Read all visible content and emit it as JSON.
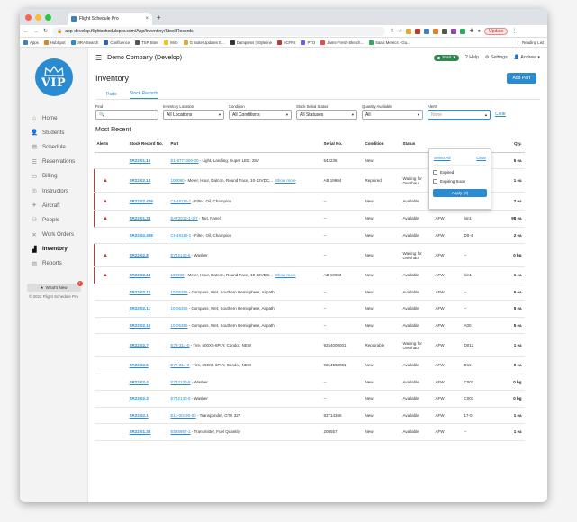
{
  "browser": {
    "tab_title": "Flight Schedule Pro",
    "url": "app-develop.flightschedulepro.com/App/Inventory/StockRecords",
    "update_label": "Update",
    "bookmarks": [
      "Apps",
      "HubSpot",
      "JIRA Search",
      "Confluence",
      "TSP Sites",
      "Miro",
      "G Suite Updates B...",
      "Dampress | Styleline",
      "eCFRs",
      "PTO",
      "Jams-Fresh-Sketch...",
      "SaaS Metrics - Gu..."
    ],
    "reading_list": "Reading List"
  },
  "sidebar": {
    "logo_text": "VIP",
    "items": [
      {
        "label": "Home",
        "icon": "home-icon",
        "glyph": "⌂"
      },
      {
        "label": "Students",
        "icon": "student-icon",
        "glyph": "👤"
      },
      {
        "label": "Schedule",
        "icon": "calendar-icon",
        "glyph": "▤"
      },
      {
        "label": "Reservations",
        "icon": "list-icon",
        "glyph": "☰"
      },
      {
        "label": "Billing",
        "icon": "billing-icon",
        "glyph": "▭"
      },
      {
        "label": "Instructors",
        "icon": "instructor-icon",
        "glyph": "◎"
      },
      {
        "label": "Aircraft",
        "icon": "airplane-icon",
        "glyph": "✈"
      },
      {
        "label": "People",
        "icon": "people-icon",
        "glyph": "⚇"
      },
      {
        "label": "Work Orders",
        "icon": "wrench-icon",
        "glyph": "✕"
      },
      {
        "label": "Inventory",
        "icon": "inventory-icon",
        "glyph": "▟"
      },
      {
        "label": "Reports",
        "icon": "chart-icon",
        "glyph": "▥"
      }
    ],
    "whats_new": "What's New",
    "whats_new_badge": "1",
    "copyright": "© 2022 Flight Schedule Pro"
  },
  "topbar": {
    "company": "Demo Company (Develop)",
    "start_label": "Start",
    "help_label": "Help",
    "settings_label": "Settings",
    "user_label": "Andrew"
  },
  "page": {
    "title": "Inventory",
    "add_button": "Add Part",
    "tabs": [
      "Parts",
      "Stock Records"
    ],
    "most_recent": "Most Recent"
  },
  "filters": {
    "find_label": "Find",
    "location_label": "Inventory Location",
    "location_value": "All Locations",
    "condition_label": "Condition",
    "condition_value": "All Conditions",
    "serial_label": "Stock Serial Status",
    "serial_value": "All Statuses",
    "qty_label": "Quantity Available",
    "qty_value": "All",
    "alerts_label": "Alerts",
    "alerts_placeholder": "None",
    "clear_label": "Clear"
  },
  "alerts_dropdown": {
    "select_all": "Select All",
    "clear": "Clear",
    "options": [
      "Expired",
      "Expiring Soon"
    ],
    "apply": "Apply (0)"
  },
  "table": {
    "headers": [
      "Alerts",
      "Stock Record No.",
      "Part",
      "Serial No.",
      "Condition",
      "Status",
      "",
      "",
      "Qty."
    ],
    "rows": [
      {
        "alert": false,
        "no": "SR22.01.16",
        "pn": "E1-8771000-00",
        "desc": " - Light, Landing, Super LED, 28V",
        "more": "",
        "serial": "542236",
        "condition": "New",
        "status": "",
        "loc": "",
        "bin": "",
        "qty": "5 ea"
      },
      {
        "alert": true,
        "no": "SR22.02.14",
        "pn": "100090",
        "desc": " - Meter, Hour, Datcon, Round Face, 10-32VDC...",
        "more": "Show more",
        "serial": "AB 19904",
        "condition": "Repaired",
        "status": "Waiting for Overhaul",
        "loc": "AFW",
        "bin": "--",
        "qty": "1 ea"
      },
      {
        "alert": true,
        "no": "SR22.02.429",
        "pn": "CH48110-1",
        "desc": " - Filter, Oil, Champion",
        "more": "",
        "serial": "--",
        "condition": "New",
        "status": "Available",
        "loc": "STO",
        "bin": "048-6",
        "qty": "7 ea"
      },
      {
        "alert": true,
        "no": "SR22.01.33",
        "pn": "EAT2012-1-2/7",
        "desc": " - Nut, Panel",
        "more": "",
        "serial": "--",
        "condition": "New",
        "status": "Available",
        "loc": "AFW",
        "bin": "bin1",
        "qty": "98 ea"
      },
      {
        "alert": false,
        "no": "SR22.02.408",
        "pn": "CH48110-1",
        "desc": " - Filter, Oil, Champion",
        "more": "",
        "serial": "--",
        "condition": "New",
        "status": "Available",
        "loc": "AFW",
        "bin": "D0-4",
        "qty": "2 ea"
      },
      {
        "alert": true,
        "no": "SR22.02.8",
        "pn": "E742130-5",
        "desc": " - Washer",
        "more": "",
        "serial": "--",
        "condition": "New",
        "status": "Waiting for Overhaul",
        "loc": "AFW",
        "bin": "--",
        "qty": "0 bg"
      },
      {
        "alert": true,
        "no": "SR22.02.13",
        "pn": "100090",
        "desc": " - Meter, Hour, Datcon, Round Face, 10-32VDC...",
        "more": "Show more",
        "serial": "AB 19903",
        "condition": "New",
        "status": "Available",
        "loc": "AFW",
        "bin": "bin1",
        "qty": "1 ea"
      },
      {
        "alert": false,
        "no": "SR22.02.12",
        "pn": "10-05355",
        "desc": " - Compass, Wet, Southern Hemisphere, Airpath",
        "more": "",
        "serial": "--",
        "condition": "New",
        "status": "Available",
        "loc": "AFW",
        "bin": "--",
        "qty": "5 ea"
      },
      {
        "alert": false,
        "no": "SR22.02.11",
        "pn": "10-05355",
        "desc": " - Compass, Wet, Southern Hemisphere, Airpath",
        "more": "",
        "serial": "--",
        "condition": "New",
        "status": "Available",
        "loc": "AFW",
        "bin": "--",
        "qty": "5 ea"
      },
      {
        "alert": false,
        "no": "SR22.02.10",
        "pn": "10-05355",
        "desc": " - Compass, Wet, Southern Hemisphere, Airpath",
        "more": "",
        "serial": "--",
        "condition": "New",
        "status": "Available",
        "loc": "AFW",
        "bin": "A00",
        "qty": "5 ea"
      },
      {
        "alert": false,
        "no": "SR22.02.7",
        "pn": "E72-314-0",
        "desc": " - Tire, 600X6-6PLY, Condor, NEW",
        "more": "",
        "serial": "9254000001",
        "condition": "Repairable",
        "status": "Waiting for Overhaul",
        "loc": "AFW",
        "bin": "D012",
        "qty": "1 ea"
      },
      {
        "alert": false,
        "no": "SR22.02.6",
        "pn": "E72-314-0",
        "desc": " - Tire, 600X6-6PLY, Condor, NEW",
        "more": "",
        "serial": "9254500001",
        "condition": "New",
        "status": "Available",
        "loc": "AFW",
        "bin": "D11",
        "qty": "0 ea"
      },
      {
        "alert": false,
        "no": "SR22.02.4",
        "pn": "E742130-5",
        "desc": " - Washer",
        "more": "",
        "serial": "--",
        "condition": "New",
        "status": "Available",
        "loc": "AFW",
        "bin": "C002",
        "qty": "0 bg"
      },
      {
        "alert": false,
        "no": "SR22.02.3",
        "pn": "E742130-5",
        "desc": " - Washer",
        "more": "",
        "serial": "--",
        "condition": "New",
        "status": "Available",
        "loc": "AFW",
        "bin": "C001",
        "qty": "0 bg"
      },
      {
        "alert": false,
        "no": "SR22.02.1",
        "pn": "E11-00430-00",
        "desc": " - Transponder, GTX 327",
        "more": "",
        "serial": "83714366",
        "condition": "New",
        "status": "Available",
        "loc": "AFW",
        "bin": "17-0",
        "qty": "1 ea"
      },
      {
        "alert": false,
        "no": "SR22.01.38",
        "pn": "E525957-1",
        "desc": " - Transmitter, Fuel Quantity",
        "more": "",
        "serial": "200557",
        "condition": "New",
        "status": "Available",
        "loc": "AFW",
        "bin": "--",
        "qty": "1 ea"
      }
    ]
  }
}
